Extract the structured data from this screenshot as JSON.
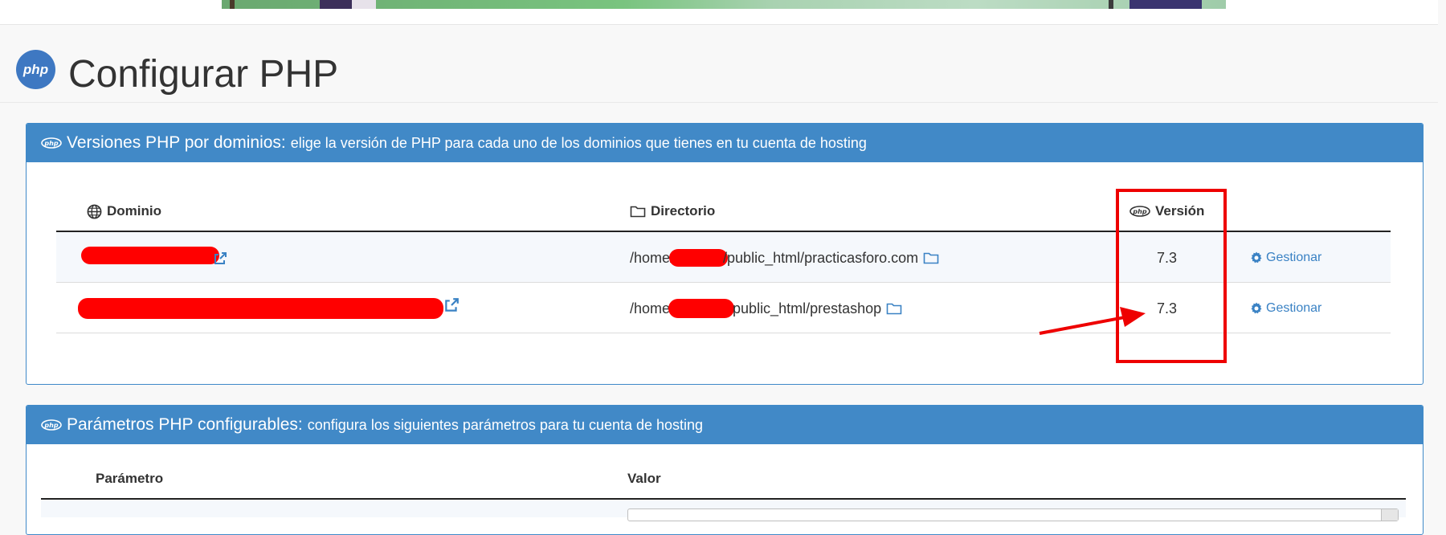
{
  "page": {
    "title": "Configurar PHP"
  },
  "logo": {
    "text": "php"
  },
  "versions_panel": {
    "title": "Versiones PHP por dominios:",
    "subtitle": "elige la versión de PHP para cada uno de los dominios que tienes en tu cuenta de hosting",
    "columns": {
      "domain": "Dominio",
      "directory": "Directorio",
      "version": "Versión"
    },
    "rows": [
      {
        "dir_prefix": "/home/",
        "dir_suffix": "/public_html/practicasforo.com",
        "version": "7.3",
        "action": "Gestionar"
      },
      {
        "dir_prefix": "/home",
        "dir_suffix": "public_html/prestashop",
        "version": "7.3",
        "action": "Gestionar"
      }
    ]
  },
  "params_panel": {
    "title": "Parámetros PHP configurables:",
    "subtitle": "configura los siguientes parámetros para tu cuenta de hosting",
    "columns": {
      "parameter": "Parámetro",
      "value": "Valor"
    }
  },
  "colors": {
    "panel_header": "#4189c7",
    "link": "#3a82c4",
    "redaction": "#ff0000",
    "highlight": "#ee0000"
  },
  "icons": {
    "domain": "globe-icon",
    "directory": "folder-icon",
    "version": "php-icon",
    "external": "external-link-icon",
    "manage": "gear-icon"
  }
}
